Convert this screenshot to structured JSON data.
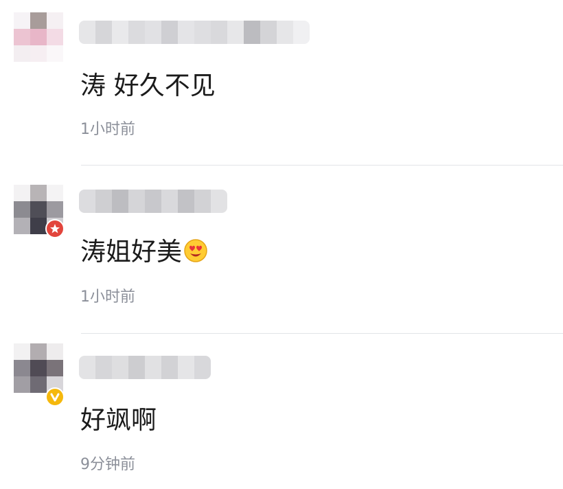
{
  "comments": [
    {
      "text": "涛 好久不见",
      "time": "1小时前",
      "avatar_colors": [
        "#f6f3f6",
        "#a89c9a",
        "#f5f0f3",
        "#ecc4d2",
        "#e8b6c8",
        "#f3dbe5",
        "#f3eef1",
        "#f6eef2",
        "#faf7f9"
      ],
      "name_colors": [
        "#e6e6e8",
        "#d6d6d9",
        "#e9e9eb",
        "#dbdbde",
        "#e1e1e4",
        "#cfcfd3",
        "#e4e4e7",
        "#dedee1",
        "#d9d9dc",
        "#e7e7e9",
        "#bcbcc0",
        "#d4d4d7",
        "#e6e6e8",
        "#f0f0f2"
      ],
      "badge": "none"
    },
    {
      "text": "涛姐好美",
      "emoji": "heart-eyes-emoji",
      "time": "1小时前",
      "avatar_colors": [
        "#f3f2f3",
        "#b8b4b6",
        "#f4f3f4",
        "#8c8b91",
        "#4f4e57",
        "#9c9aa0",
        "#b3b1b6",
        "#3f3e49",
        "#cfcdd1"
      ],
      "name_colors": [
        "#dcdcdf",
        "#cfcfd2",
        "#bdbdc1",
        "#d5d5d8",
        "#c8c8cc",
        "#d9d9dc",
        "#c2c2c6",
        "#d2d2d5",
        "#e2e2e4"
      ],
      "badge": "red-star-badge",
      "badge_color": "#e2453c"
    },
    {
      "text": "好飒啊",
      "time": "9分钟前",
      "avatar_colors": [
        "#f2f1f2",
        "#b2adb0",
        "#eeeced",
        "#8b8890",
        "#504b55",
        "#7a7379",
        "#a19ea4",
        "#6f6b74",
        "#d8d6da"
      ],
      "name_colors": [
        "#e3e3e5",
        "#d6d6d9",
        "#dedee0",
        "#cdcdd0",
        "#e1e1e3",
        "#d2d2d5",
        "#e5e5e7",
        "#d8d8db"
      ],
      "badge": "gold-v-badge",
      "badge_color": "#f5b80d"
    }
  ],
  "colors": {
    "text": "#1b1b1b",
    "timestamp": "#8b8f99",
    "divider": "#e2e4e8",
    "background": "#ffffff"
  }
}
